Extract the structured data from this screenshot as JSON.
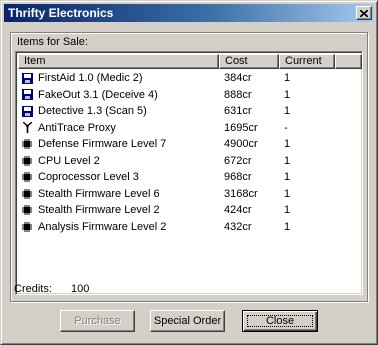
{
  "window": {
    "title": "Thrifty Electronics"
  },
  "group_label": "Items for Sale:",
  "columns": {
    "item": "Item",
    "cost": "Cost",
    "current": "Current"
  },
  "rows": [
    {
      "icon": "floppy-disk-icon",
      "item": "FirstAid 1.0 (Medic 2)",
      "cost": "384cr",
      "current": "1"
    },
    {
      "icon": "floppy-disk-icon",
      "item": "FakeOut 3.1 (Deceive 4)",
      "cost": "888cr",
      "current": "1"
    },
    {
      "icon": "floppy-disk-icon",
      "item": "Detective 1.3 (Scan 5)",
      "cost": "631cr",
      "current": "1"
    },
    {
      "icon": "antenna-icon",
      "item": "AntiTrace Proxy",
      "cost": "1695cr",
      "current": "-"
    },
    {
      "icon": "chip-icon",
      "item": "Defense Firmware  Level 7",
      "cost": "4900cr",
      "current": "1"
    },
    {
      "icon": "chip-icon",
      "item": "CPU  Level 2",
      "cost": "672cr",
      "current": "1"
    },
    {
      "icon": "chip-icon",
      "item": "Coprocessor  Level 3",
      "cost": "968cr",
      "current": "1"
    },
    {
      "icon": "chip-icon",
      "item": "Stealth Firmware  Level 6",
      "cost": "3168cr",
      "current": "1"
    },
    {
      "icon": "chip-icon",
      "item": "Stealth Firmware  Level 2",
      "cost": "424cr",
      "current": "1"
    },
    {
      "icon": "chip-icon",
      "item": "Analysis Firmware  Level 2",
      "cost": "432cr",
      "current": "1"
    }
  ],
  "credits": {
    "label": "Credits:",
    "value": "100"
  },
  "buttons": {
    "purchase": "Purchase",
    "special_order": "Special Order",
    "close": "Close"
  },
  "colors": {
    "disk_blue": "#000080",
    "title_start": "#0a246a",
    "title_end": "#a6caf0"
  }
}
